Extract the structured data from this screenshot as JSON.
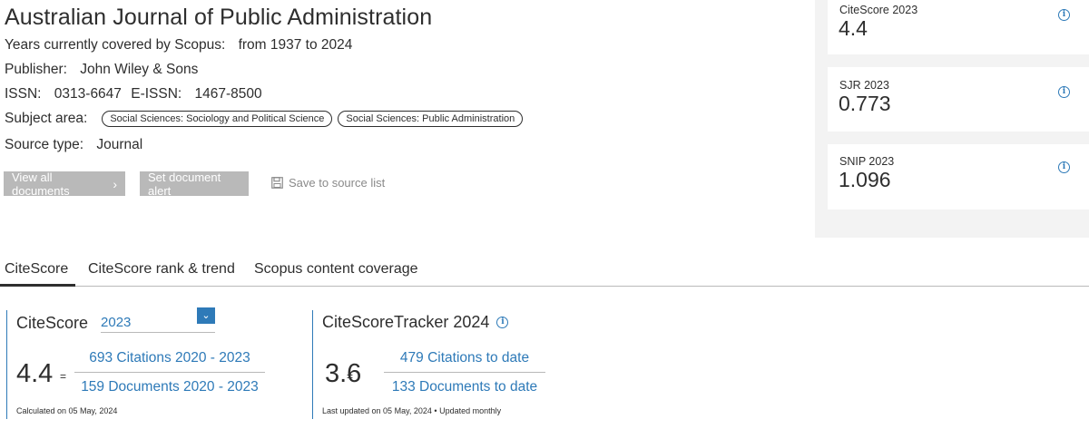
{
  "journal": {
    "title": "Australian Journal of Public Administration",
    "years_label": "Years currently covered by Scopus:",
    "years_value": "from 1937 to 2024",
    "publisher_label": "Publisher:",
    "publisher_value": "John Wiley & Sons",
    "issn_label": "ISSN:",
    "issn_value": "0313-6647",
    "eissn_label": "E-ISSN:",
    "eissn_value": "1467-8500",
    "subject_label": "Subject area:",
    "subjects": [
      "Social Sciences: Sociology and Political Science",
      "Social Sciences: Public Administration"
    ],
    "source_type_label": "Source type:",
    "source_type_value": "Journal"
  },
  "actions": {
    "view_all": "View all documents",
    "set_alert": "Set document alert",
    "save_to_list": "Save to source list"
  },
  "metrics": {
    "citescore": {
      "label": "CiteScore 2023",
      "value": "4.4"
    },
    "sjr": {
      "label": "SJR 2023",
      "value": "0.773"
    },
    "snip": {
      "label": "SNIP 2023",
      "value": "1.096"
    }
  },
  "tabs": [
    "CiteScore",
    "CiteScore rank & trend",
    "Scopus content coverage"
  ],
  "citescore_panel": {
    "heading": "CiteScore",
    "year": "2023",
    "value": "4.4",
    "equals": "=",
    "numerator": "693 Citations 2020 - 2023",
    "denominator": "159 Documents 2020 - 2023",
    "note": "Calculated on 05 May, 2024"
  },
  "tracker_panel": {
    "heading": "CiteScoreTracker 2024",
    "value": "3.6",
    "equals": "=",
    "numerator": "479 Citations to date",
    "denominator": "133 Documents to date",
    "note": "Last updated on 05 May, 2024 • Updated monthly"
  },
  "colors": {
    "link_blue": "#2e7ab8",
    "button_gray": "#b9b9b9",
    "text": "#2e2e2e"
  },
  "icons": {
    "info": "info-icon",
    "save": "save-icon",
    "dropdown": "chevron-down-icon",
    "chevron_right": "chevron-right-icon"
  }
}
